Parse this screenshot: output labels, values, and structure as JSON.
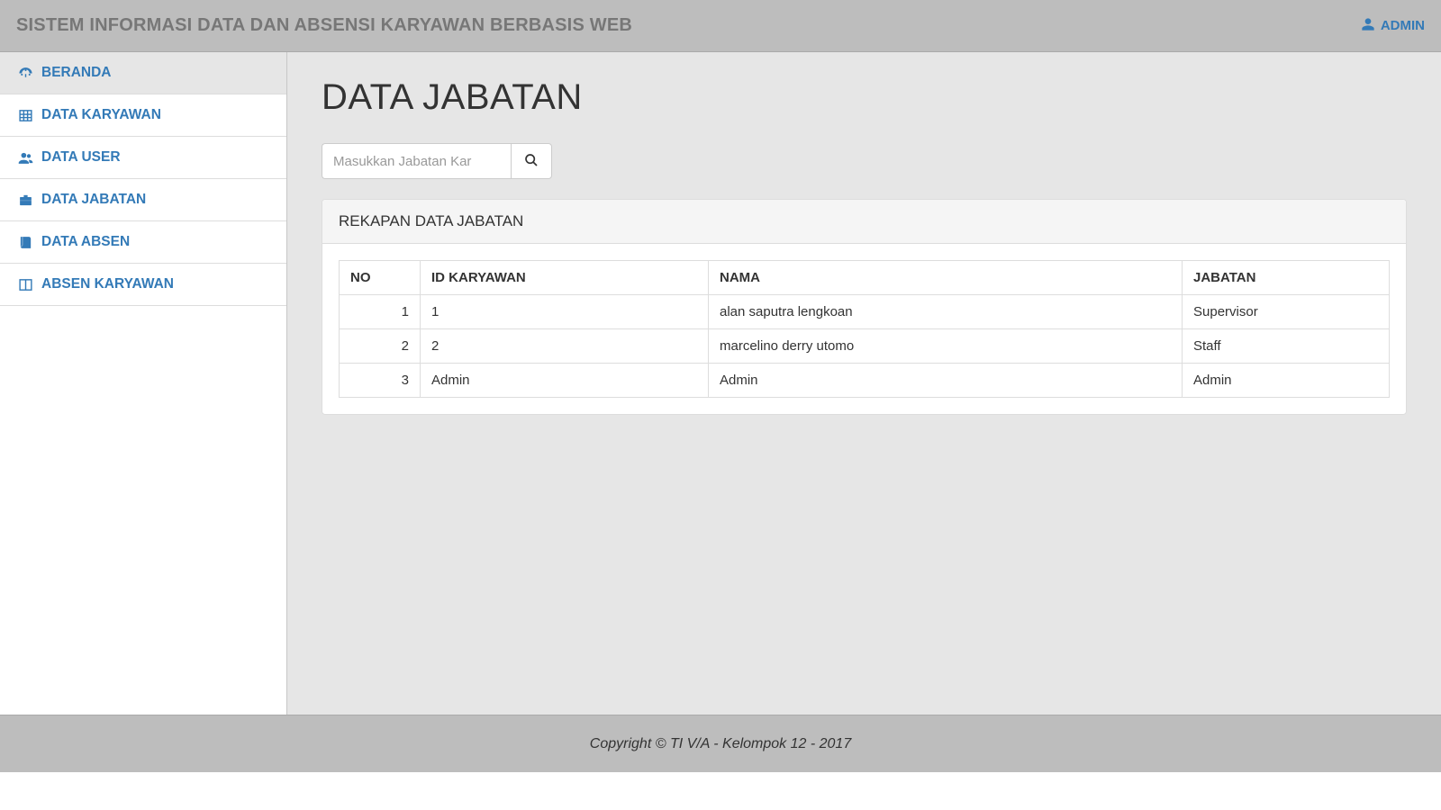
{
  "header": {
    "brand": "SISTEM INFORMASI DATA DAN ABSENSI KARYAWAN BERBASIS WEB",
    "user_label": "ADMIN"
  },
  "sidebar": {
    "items": [
      {
        "label": "BERANDA"
      },
      {
        "label": "DATA KARYAWAN"
      },
      {
        "label": "DATA USER"
      },
      {
        "label": "DATA JABATAN"
      },
      {
        "label": "DATA ABSEN"
      },
      {
        "label": "ABSEN KARYAWAN"
      }
    ]
  },
  "main": {
    "title": "DATA JABATAN",
    "search": {
      "placeholder": "Masukkan Jabatan Kar",
      "value": ""
    },
    "panel_title": "REKAPAN DATA JABATAN",
    "table": {
      "headers": {
        "no": "NO",
        "id": "ID KARYAWAN",
        "nama": "NAMA",
        "jabatan": "JABATAN"
      },
      "rows": [
        {
          "no": "1",
          "id": "1",
          "nama": "alan saputra lengkoan",
          "jabatan": "Supervisor"
        },
        {
          "no": "2",
          "id": "2",
          "nama": "marcelino derry utomo",
          "jabatan": "Staff"
        },
        {
          "no": "3",
          "id": "Admin",
          "nama": "Admin",
          "jabatan": "Admin"
        }
      ]
    }
  },
  "footer": {
    "text": "Copyright © TI V/A - Kelompok 12 - 2017"
  }
}
